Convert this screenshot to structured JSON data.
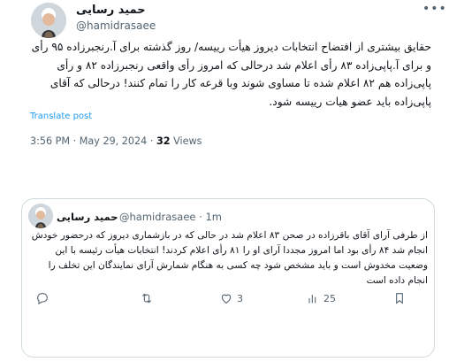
{
  "post": {
    "author_name": "حمید رسایی",
    "author_handle": "@hamidrasaee",
    "text": "حقایق بیشتری از افتضاح انتخابات دیروز هیأت رییسه/ روز گذشته برای آ.رنجبرزاده ۹۵ رأی و برای آ.پاپی‌زاده ۸۳ رأی اعلام شد درحالی که امروز رأی واقعی رنجبرزاده ۸۲ و رأی پاپی‌زاده هم ۸۲ اعلام شده تا مساوی شوند وبا قرعه کار را تمام کنند! درحالی که آقای پاپی‌زاده باید عضو هیات رییسه شود.",
    "translate_label": "Translate post",
    "time": "3:56 PM",
    "separator": "·",
    "date": "May 29, 2024",
    "views_count": "32",
    "views_label": "Views",
    "more_icon": "more-icon"
  },
  "quote": {
    "author_name": "حمید رسایی",
    "author_handle": "@hamidrasaee",
    "age": "· 1m",
    "text": "از طرفی آرای آقای باقرزاده در صحن ۸۳ اعلام شد در حالی که در بازشماری دیروز که درحضور خودش انجام شد ۸۴ رأی بود اما امروز مجددا آرای او را ۸۱ رأی اعلام کردند! انتخابات هیأت رئیسه با این وضعیت مخدوش است و باید مشخص شود چه کسی به هنگام شمارش آرای نمایندگان این تخلف را انجام داده است"
  },
  "actions": {
    "reply_count": "",
    "retweet_count": "",
    "like_count": "3",
    "views_count": "25"
  },
  "colors": {
    "text": "#0f1419",
    "secondary": "#536471",
    "link": "#1d9bf0",
    "border": "#cfd9de",
    "gap_bg": "#f7f9f9"
  }
}
